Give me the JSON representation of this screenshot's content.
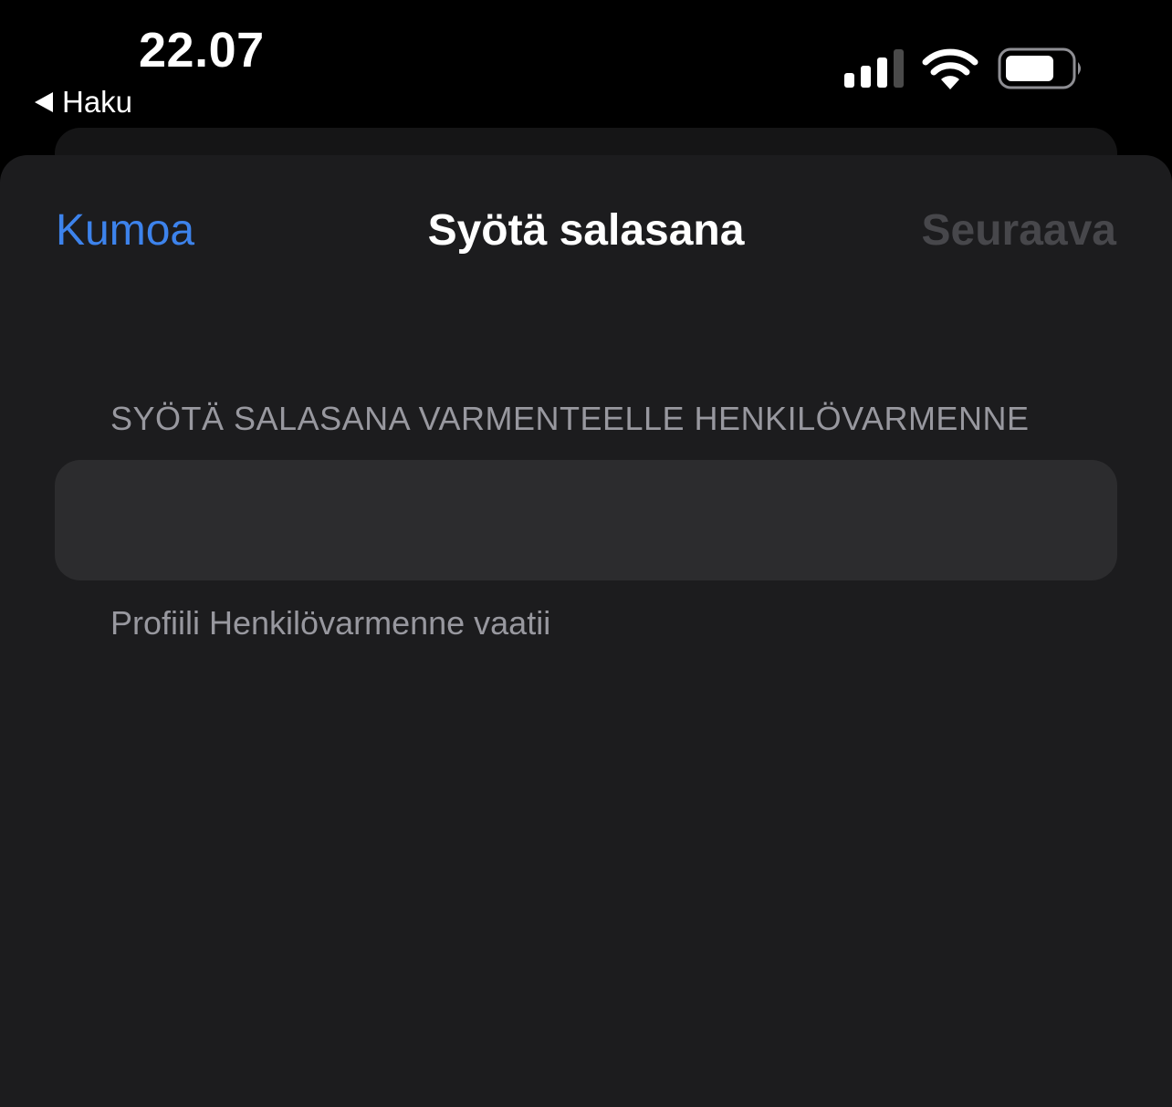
{
  "status_bar": {
    "time": "22.07",
    "back_label": "Haku",
    "icons": [
      "cellular-signal-icon",
      "wifi-icon",
      "battery-icon"
    ]
  },
  "nav": {
    "cancel_label": "Kumoa",
    "title": "Syötä salasana",
    "next_label": "Seuraava"
  },
  "form": {
    "header": "SYÖTÄ SALASANA VARMENTEELLE HENKILÖVARMENNE",
    "password_value": "",
    "footer": "Profiili Henkilövarmenne vaatii"
  },
  "colors": {
    "accent": "#3d83ec",
    "disabled": "#47474b",
    "sheet_background": "#1c1c1e",
    "field_background": "#2c2c2e",
    "secondary_text": "#98989f"
  }
}
